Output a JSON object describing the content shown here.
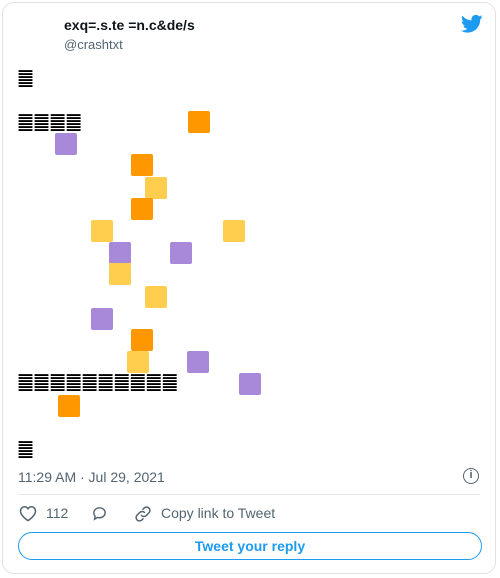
{
  "tweet": {
    "author_name": "exq=.s.te =n.c&de/s",
    "handle": "@crashtxt",
    "line1": "䷀",
    "line2": "䷀䷀䷀䷀",
    "line3": "䷀䷀䷀䷀䷀䷀䷀䷀䷀䷀",
    "line4": "䷀",
    "timestamp": "11:29 AM · Jul 29, 2021",
    "likes": "112",
    "copy_link_label": "Copy link to Tweet",
    "reply_button_label": "Tweet your reply"
  },
  "colors": {
    "orange": "#ff9800",
    "yellow": "#ffce4f",
    "purple": "#a889d9",
    "twitter_blue": "#1d9bf0"
  },
  "icons": [
    "twitter-bird-icon",
    "info-icon",
    "heart-icon",
    "reply-bubble-icon",
    "link-icon"
  ]
}
